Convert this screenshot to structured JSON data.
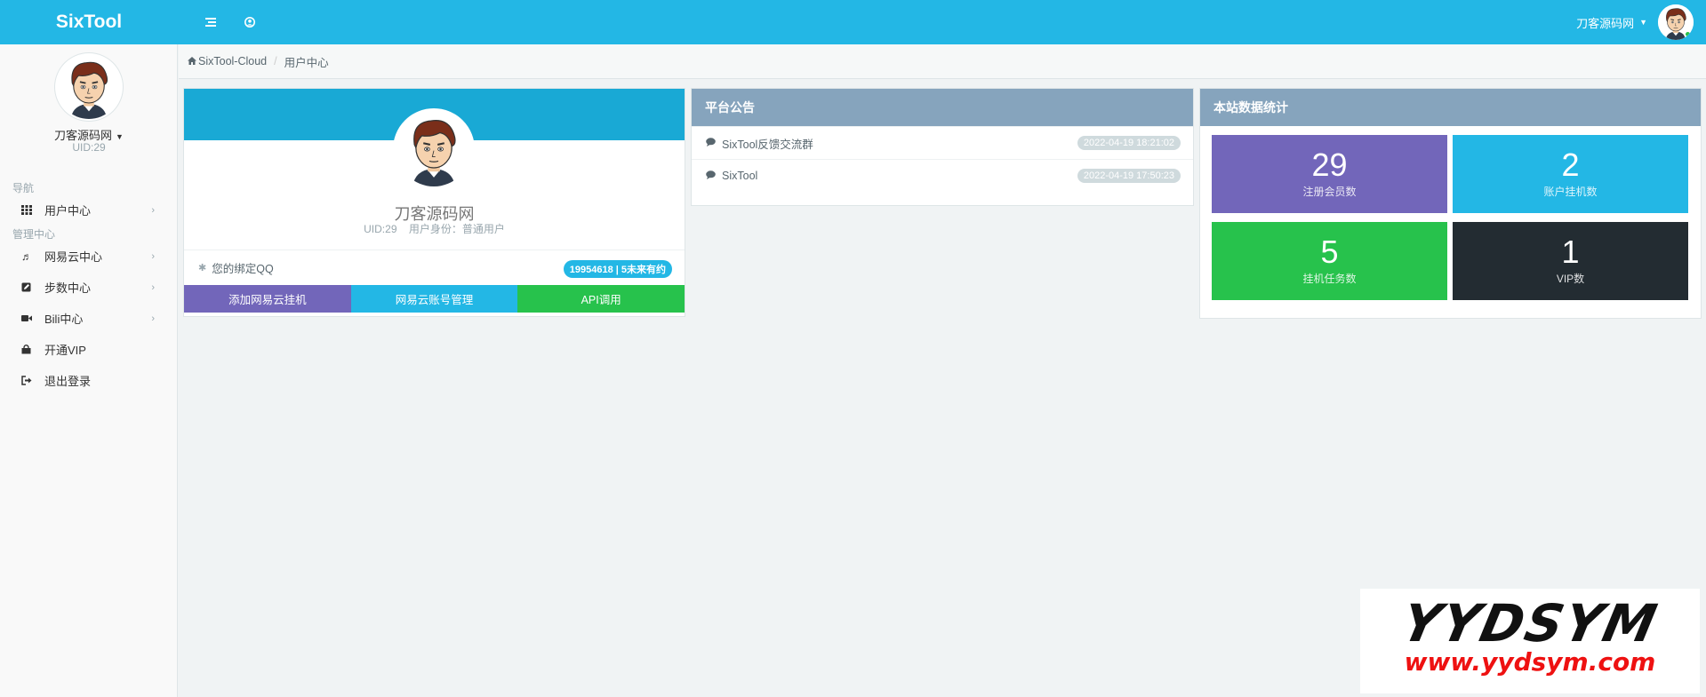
{
  "brand": "SixTool",
  "topbar": {
    "menu_icon": "menu-icon",
    "user_circle_icon": "user-circle-icon",
    "user_name": "刀客源码网"
  },
  "sidebar": {
    "user_name": "刀客源码网",
    "uid": "UID:29",
    "section_nav": "导航",
    "section_admin": "管理中心",
    "items": [
      {
        "label": "用户中心",
        "icon": "grid-icon",
        "arrow": true
      },
      {
        "label": "网易云中心",
        "icon": "music-icon",
        "arrow": true
      },
      {
        "label": "步数中心",
        "icon": "edit-icon",
        "arrow": true
      },
      {
        "label": "Bili中心",
        "icon": "video-icon",
        "arrow": true
      },
      {
        "label": "开通VIP",
        "icon": "bag-icon",
        "arrow": false
      },
      {
        "label": "退出登录",
        "icon": "logout-icon",
        "arrow": false
      }
    ]
  },
  "breadcrumb": {
    "home": "SixTool-Cloud",
    "current": "用户中心"
  },
  "profile": {
    "name": "刀客源码网",
    "uid": "UID:29",
    "role": "用户身份：普通用户",
    "qq_label": "您的绑定QQ",
    "qq_badge": "19954618 | 5未来有约",
    "buttons": [
      {
        "label": "添加网易云挂机",
        "color": "#7266ba"
      },
      {
        "label": "网易云账号管理",
        "color": "#23b7e5"
      },
      {
        "label": "API调用",
        "color": "#27c24c"
      }
    ]
  },
  "notices": {
    "title": "平台公告",
    "items": [
      {
        "text": "SixTool反馈交流群",
        "time": "2022-04-19 18:21:02"
      },
      {
        "text": "SixTool",
        "time": "2022-04-19 17:50:23"
      }
    ]
  },
  "stats": {
    "title": "本站数据统计",
    "items": [
      {
        "value": "29",
        "label": "注册会员数",
        "color": "#7266ba"
      },
      {
        "value": "2",
        "label": "账户挂机数",
        "color": "#23b7e5"
      },
      {
        "value": "5",
        "label": "挂机任务数",
        "color": "#27c24c"
      },
      {
        "value": "1",
        "label": "VIP数",
        "color": "#232c32"
      }
    ]
  },
  "watermark": {
    "logo": "YYDSYM",
    "url": "www.yydsym.com"
  }
}
